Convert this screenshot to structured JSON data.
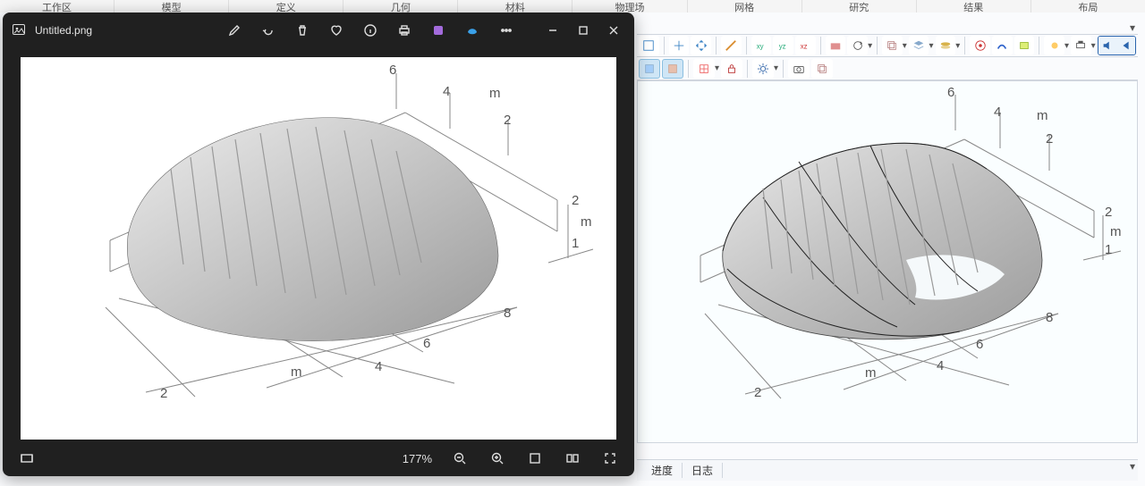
{
  "ribbon_tabs": [
    "工作区",
    "模型",
    "定义",
    "几何",
    "材料",
    "物理场",
    "网格",
    "研究",
    "结果",
    "布局"
  ],
  "comsol_bottom_tabs": {
    "progress": "进度",
    "log": "日志"
  },
  "photos": {
    "filename": "Untitled.png",
    "zoom": "177%"
  },
  "axes3d": {
    "unit": "m",
    "top_row": [
      "6",
      "4",
      "2"
    ],
    "right_col": [
      "2",
      "1"
    ],
    "front_row": [
      "8",
      "6",
      "4",
      "2"
    ]
  }
}
